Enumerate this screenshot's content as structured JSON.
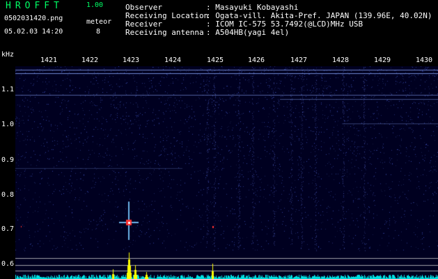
{
  "app": {
    "title": "HROFFT",
    "version": "1.00"
  },
  "file": {
    "name": "0502031420.png",
    "timestamp": "05.02.03 14:20"
  },
  "meteor": {
    "label": "meteor",
    "count": "8"
  },
  "station_info": [
    {
      "label": "Observer",
      "value": ": Masayuki Kobayashi"
    },
    {
      "label": "Receiving Location",
      "value": ": Ogata-vill. Akita-Pref. JAPAN (139.96E, 40.02N)"
    },
    {
      "label": "Receiver",
      "value": ": ICOM IC-575 53.7492(@LCD)MHz USB"
    },
    {
      "label": "Receiving antenna",
      "value": ": A504HB(yagi 4el)"
    }
  ],
  "axes": {
    "unit": "kHz",
    "time_ticks": [
      "1421",
      "1422",
      "1423",
      "1424",
      "1425",
      "1426",
      "1427",
      "1428",
      "1429",
      "1430"
    ],
    "freq_ticks": [
      "1.1",
      "1.0",
      "0.9",
      "0.8",
      "0.7",
      "0.6"
    ]
  },
  "colors": {
    "title_accent": "#00ff66",
    "spectrogram_bg": "#000020",
    "noise": "#2a3aa8",
    "spectrum_line": "#00e0e0",
    "spectrum_peak": "#ffff00",
    "meteor_echo": "#ff3030"
  }
}
